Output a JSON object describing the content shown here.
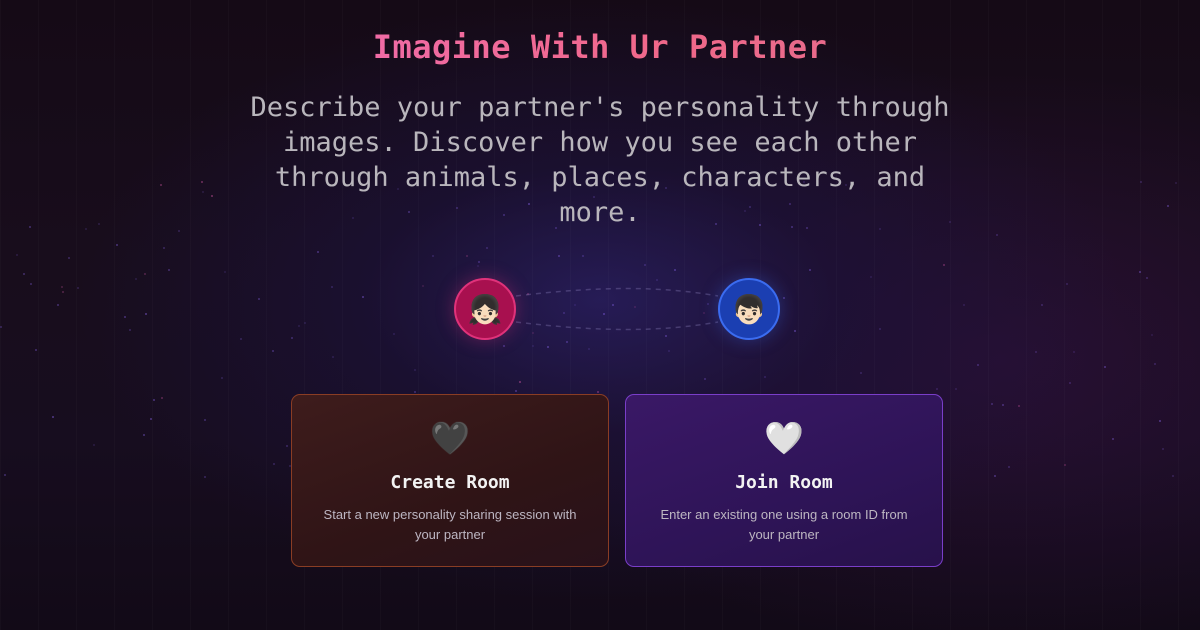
{
  "header": {
    "title": "Imagine With Ur Partner",
    "subtitle": "Describe your partner's personality through images. Discover how you see each other through animals, places, characters, and more."
  },
  "avatars": {
    "partner_a": {
      "emoji": "👧🏻",
      "icon": "girl-avatar-icon",
      "color": "#a8104f"
    },
    "partner_b": {
      "emoji": "👦🏻",
      "icon": "boy-avatar-icon",
      "color": "#1b3fb2"
    }
  },
  "cards": {
    "create": {
      "icon_glyph": "🖤",
      "icon": "black-heart-icon",
      "title": "Create Room",
      "description": "Start a new personality sharing session with your partner",
      "accent": "#8a3d24"
    },
    "join": {
      "icon_glyph": "🤍",
      "icon": "white-heart-icon",
      "title": "Join Room",
      "description": "Enter an existing one using a room ID from your partner",
      "accent": "#7a3ec9"
    }
  },
  "theme": {
    "background": "#150a16",
    "title_gradient": [
      "#f06fc8",
      "#f0688a"
    ]
  }
}
